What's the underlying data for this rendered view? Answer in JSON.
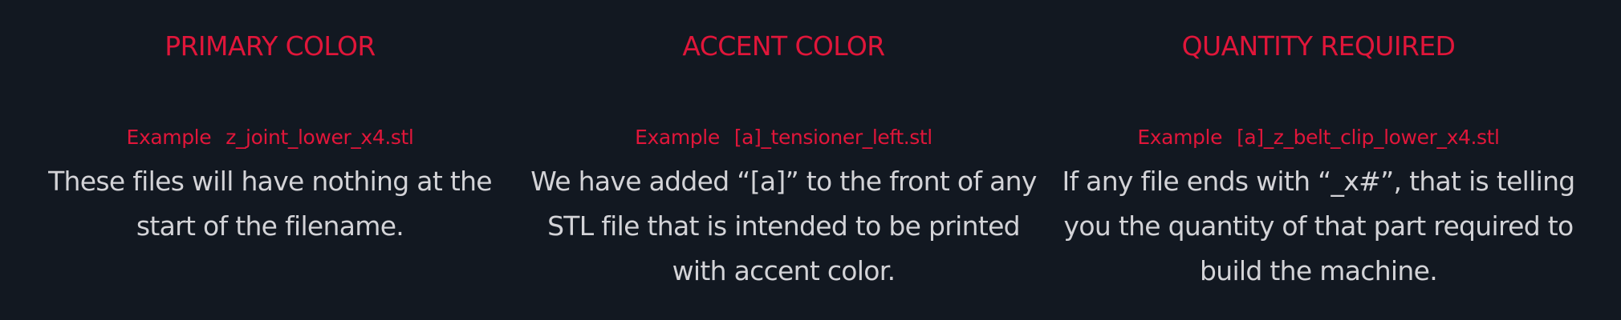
{
  "colors": {
    "background": "#121821",
    "accent": "#e0163a",
    "body_text": "#d3d3d7"
  },
  "columns": [
    {
      "heading": "PRIMARY COLOR",
      "example_label": "Example",
      "example_file": "z_joint_lower_x4.stl",
      "description_lines": [
        "These files will have nothing at the",
        "start of the filename."
      ]
    },
    {
      "heading": "ACCENT COLOR",
      "example_label": "Example",
      "example_file": "[a]_tensioner_left.stl",
      "description_lines": [
        "We have added “[a]” to the front of any",
        "STL file that is intended to be printed",
        "with accent color."
      ]
    },
    {
      "heading": "QUANTITY REQUIRED",
      "example_label": "Example",
      "example_file": "[a]_z_belt_clip_lower_x4.stl",
      "description_lines": [
        "If any file ends with “_x#”, that is telling",
        "you the quantity of that part required to",
        "build the machine."
      ]
    }
  ]
}
